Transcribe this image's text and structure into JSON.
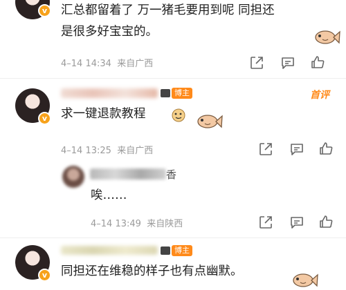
{
  "comments": [
    {
      "text_line1": "汇总都留着了 万一猪毛要用到呢 同担还",
      "text_line2": "是很多好宝宝的。",
      "time": "4–14 14:34",
      "location": "来自广西"
    },
    {
      "badge": "博主",
      "pinned": "首评",
      "text": "求一键退款教程",
      "time": "4–14 13:25",
      "location": "来自广西"
    },
    {
      "username_partial": "香",
      "text": "唉……",
      "time": "4–14 13:49",
      "location": "来自陕西"
    },
    {
      "badge": "博主",
      "text": "同担还在维稳的样子也有点幽默。"
    }
  ],
  "colors": {
    "accent": "#ff8a1a",
    "meta": "#9a9a9a",
    "text": "#222222",
    "vbadge": "#f7a21b"
  },
  "icons": [
    "share-icon",
    "comment-icon",
    "like-icon",
    "fish-sticker-icon",
    "verified-badge-icon"
  ]
}
